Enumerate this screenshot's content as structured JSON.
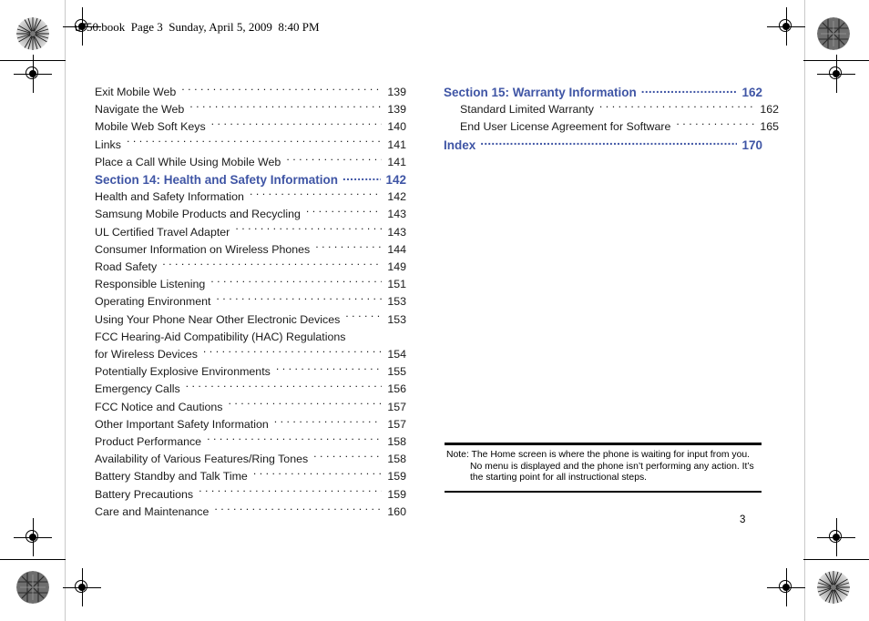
{
  "file_header": "u750.book  Page 3  Sunday, April 5, 2009  8:40 PM",
  "page_number": "3",
  "colors": {
    "section_heading": "#3f55a5",
    "body_text": "#1a1a1a",
    "rule": "#000000"
  },
  "toc": {
    "left_column": [
      {
        "type": "entry",
        "label": "Exit Mobile Web",
        "page": "139"
      },
      {
        "type": "entry",
        "label": "Navigate the Web",
        "page": "139"
      },
      {
        "type": "entry",
        "label": "Mobile Web Soft Keys",
        "page": "140"
      },
      {
        "type": "entry",
        "label": "Links",
        "page": "141"
      },
      {
        "type": "entry",
        "label": "Place a Call While Using Mobile Web",
        "page": "141"
      },
      {
        "type": "section",
        "label": "Section 14:  Health and Safety Information",
        "page": "142"
      },
      {
        "type": "entry",
        "label": "Health and Safety Information",
        "page": "142"
      },
      {
        "type": "entry",
        "label": "Samsung Mobile Products and Recycling",
        "page": "143"
      },
      {
        "type": "entry",
        "label": "UL Certified Travel Adapter",
        "page": "143"
      },
      {
        "type": "entry",
        "label": "Consumer Information on Wireless Phones",
        "page": "144"
      },
      {
        "type": "entry",
        "label": "Road Safety",
        "page": "149"
      },
      {
        "type": "entry",
        "label": "Responsible Listening",
        "page": "151"
      },
      {
        "type": "entry",
        "label": "Operating Environment",
        "page": "153"
      },
      {
        "type": "entry",
        "label": "Using Your Phone Near Other Electronic Devices",
        "page": "153"
      },
      {
        "type": "entry-cont",
        "label": "FCC Hearing-Aid Compatibility (HAC) Regulations",
        "page": ""
      },
      {
        "type": "entry",
        "label": "for Wireless Devices",
        "page": "154"
      },
      {
        "type": "entry",
        "label": "Potentially Explosive Environments",
        "page": "155"
      },
      {
        "type": "entry",
        "label": "Emergency Calls",
        "page": "156"
      },
      {
        "type": "entry",
        "label": "FCC Notice and Cautions",
        "page": "157"
      },
      {
        "type": "entry",
        "label": "Other Important Safety Information",
        "page": "157"
      },
      {
        "type": "entry",
        "label": "Product Performance",
        "page": "158"
      },
      {
        "type": "entry",
        "label": "Availability of Various Features/Ring Tones",
        "page": "158"
      },
      {
        "type": "entry",
        "label": "Battery Standby and Talk Time",
        "page": "159"
      },
      {
        "type": "entry",
        "label": "Battery Precautions",
        "page": "159"
      },
      {
        "type": "entry",
        "label": "Care and Maintenance",
        "page": "160"
      }
    ],
    "right_column": [
      {
        "type": "section",
        "label": "Section 15:  Warranty Information",
        "page": "162"
      },
      {
        "type": "entry",
        "label": "Standard Limited Warranty",
        "page": "162"
      },
      {
        "type": "entry",
        "label": "End User License Agreement for Software",
        "page": "165"
      },
      {
        "type": "section",
        "label": "Index",
        "page": "170"
      }
    ]
  },
  "note": {
    "label": "Note:",
    "text": "The Home screen is where the phone is waiting for input from you. No menu is displayed and the phone isn’t performing any action. It’s the starting point for all instructional steps."
  }
}
